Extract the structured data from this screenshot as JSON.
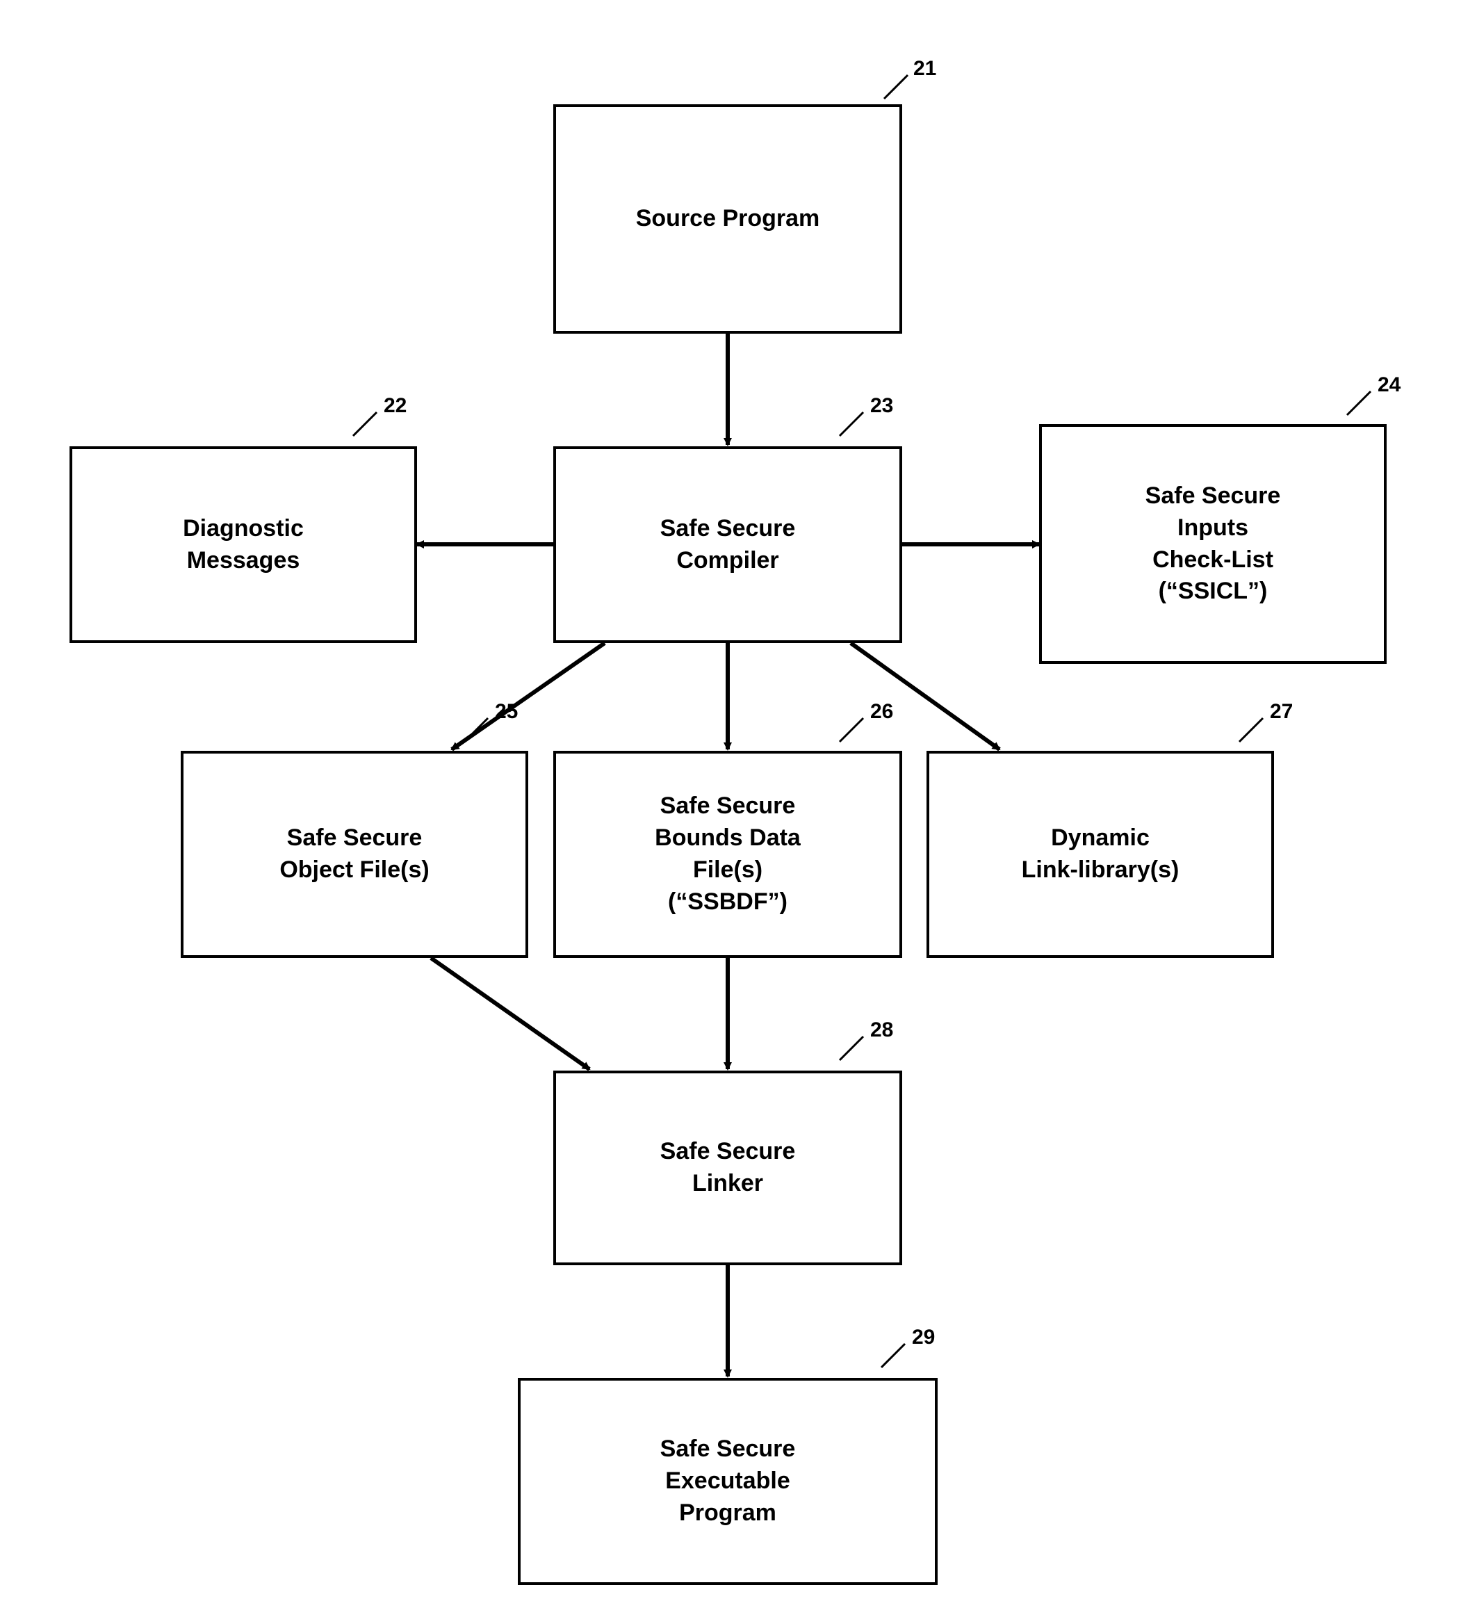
{
  "diagram": {
    "boxes": {
      "b21": {
        "ref": "21",
        "text": "Source Program"
      },
      "b22": {
        "ref": "22",
        "text": "Diagnostic\nMessages"
      },
      "b23": {
        "ref": "23",
        "text": "Safe Secure\nCompiler"
      },
      "b24": {
        "ref": "24",
        "text": "Safe Secure\nInputs\nCheck-List\n(“SSICL”)"
      },
      "b25": {
        "ref": "25",
        "text": "Safe Secure\nObject File(s)"
      },
      "b26": {
        "ref": "26",
        "text": "Safe Secure\nBounds Data\nFile(s)\n(“SSBDF”)"
      },
      "b27": {
        "ref": "27",
        "text": "Dynamic\nLink-library(s)"
      },
      "b28": {
        "ref": "28",
        "text": "Safe Secure\nLinker"
      },
      "b29": {
        "ref": "29",
        "text": "Safe Secure\nExecutable\nProgram"
      }
    }
  }
}
